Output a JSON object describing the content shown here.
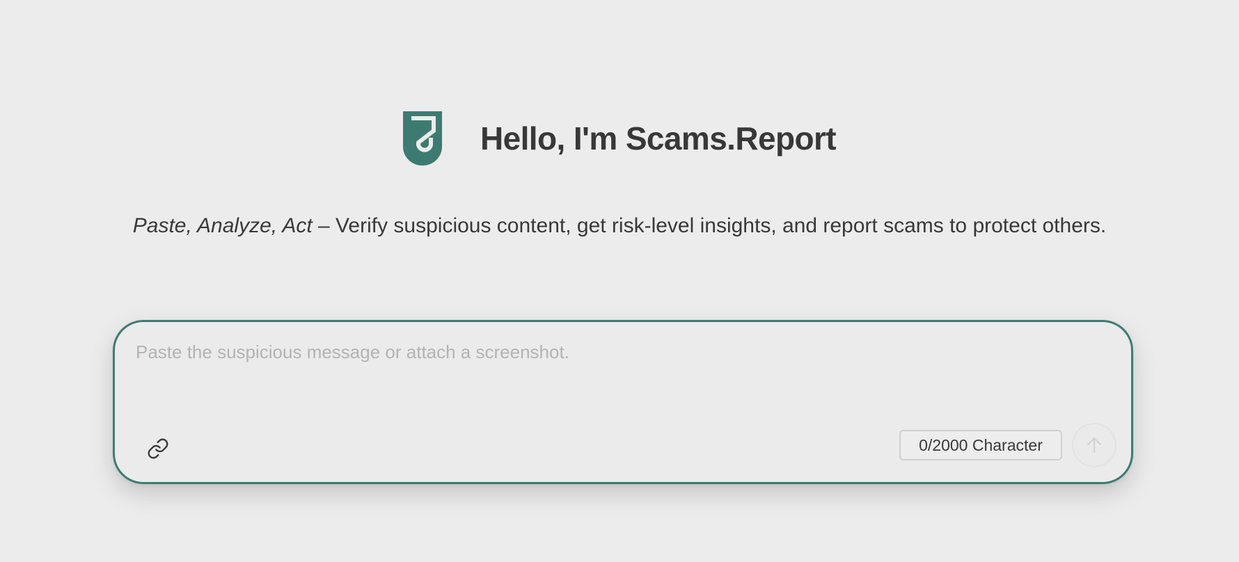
{
  "header": {
    "logo_icon": "shield-s-logo-icon",
    "title": "Hello, I'm Scams.Report"
  },
  "tagline": {
    "emphasis": "Paste, Analyze, Act",
    "text": " – Verify suspicious content, get risk-level insights, and report scams to protect others."
  },
  "composer": {
    "placeholder": "Paste the suspicious message or attach a screenshot.",
    "value": "",
    "attach_icon": "link-icon",
    "counter": "0/2000 Character",
    "send_icon": "arrow-up-icon"
  },
  "colors": {
    "brand": "#3d7b72",
    "background": "#ececec",
    "text": "#383838",
    "placeholder": "#b3b3b3"
  }
}
